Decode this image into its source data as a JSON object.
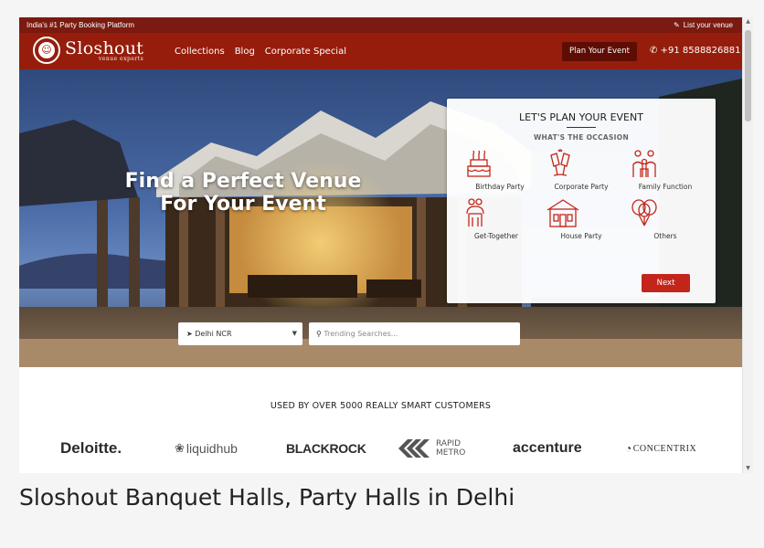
{
  "topbar": {
    "tagline": "India's #1 Party Booking Platform",
    "list_venue": "List your venue",
    "list_icon": "pencil-icon"
  },
  "nav": {
    "brand": "Sloshout",
    "brand_tag": "venue experts",
    "links": [
      "Collections",
      "Blog",
      "Corporate Special"
    ],
    "plan_button": "Plan Your Event",
    "phone": "+91 8588826881",
    "phone_icon": "phone-icon"
  },
  "hero": {
    "title_line1": "Find a Perfect Venue",
    "title_line2": "For Your Event"
  },
  "plan": {
    "title": "LET'S PLAN YOUR EVENT",
    "subtitle": "WHAT'S THE OCCASION",
    "occasions": [
      {
        "label": "Birthday Party",
        "icon": "birthday-cake-icon"
      },
      {
        "label": "Corporate Party",
        "icon": "cheers-icon"
      },
      {
        "label": "Family Function",
        "icon": "family-icon"
      },
      {
        "label": "Get-Together",
        "icon": "people-icon"
      },
      {
        "label": "House Party",
        "icon": "house-icon"
      },
      {
        "label": "Others",
        "icon": "balloons-icon"
      }
    ],
    "next": "Next"
  },
  "search": {
    "city": "Delhi NCR",
    "city_icon": "location-arrow-icon",
    "placeholder": "Trending Searches...",
    "search_icon": "search-icon"
  },
  "customers": {
    "heading": "USED BY OVER 5000 REALLY SMART CUSTOMERS",
    "brands": [
      "Deloitte.",
      "liquidhub",
      "BLACKROCK",
      "RAPID",
      "METRO",
      "accenture",
      "CONCENTRIX"
    ]
  },
  "caption": "Sloshout Banquet Halls, Party Halls in Delhi",
  "colors": {
    "primary": "#961d0c",
    "topbar": "#7a1a10",
    "accent": "#c4251b"
  }
}
